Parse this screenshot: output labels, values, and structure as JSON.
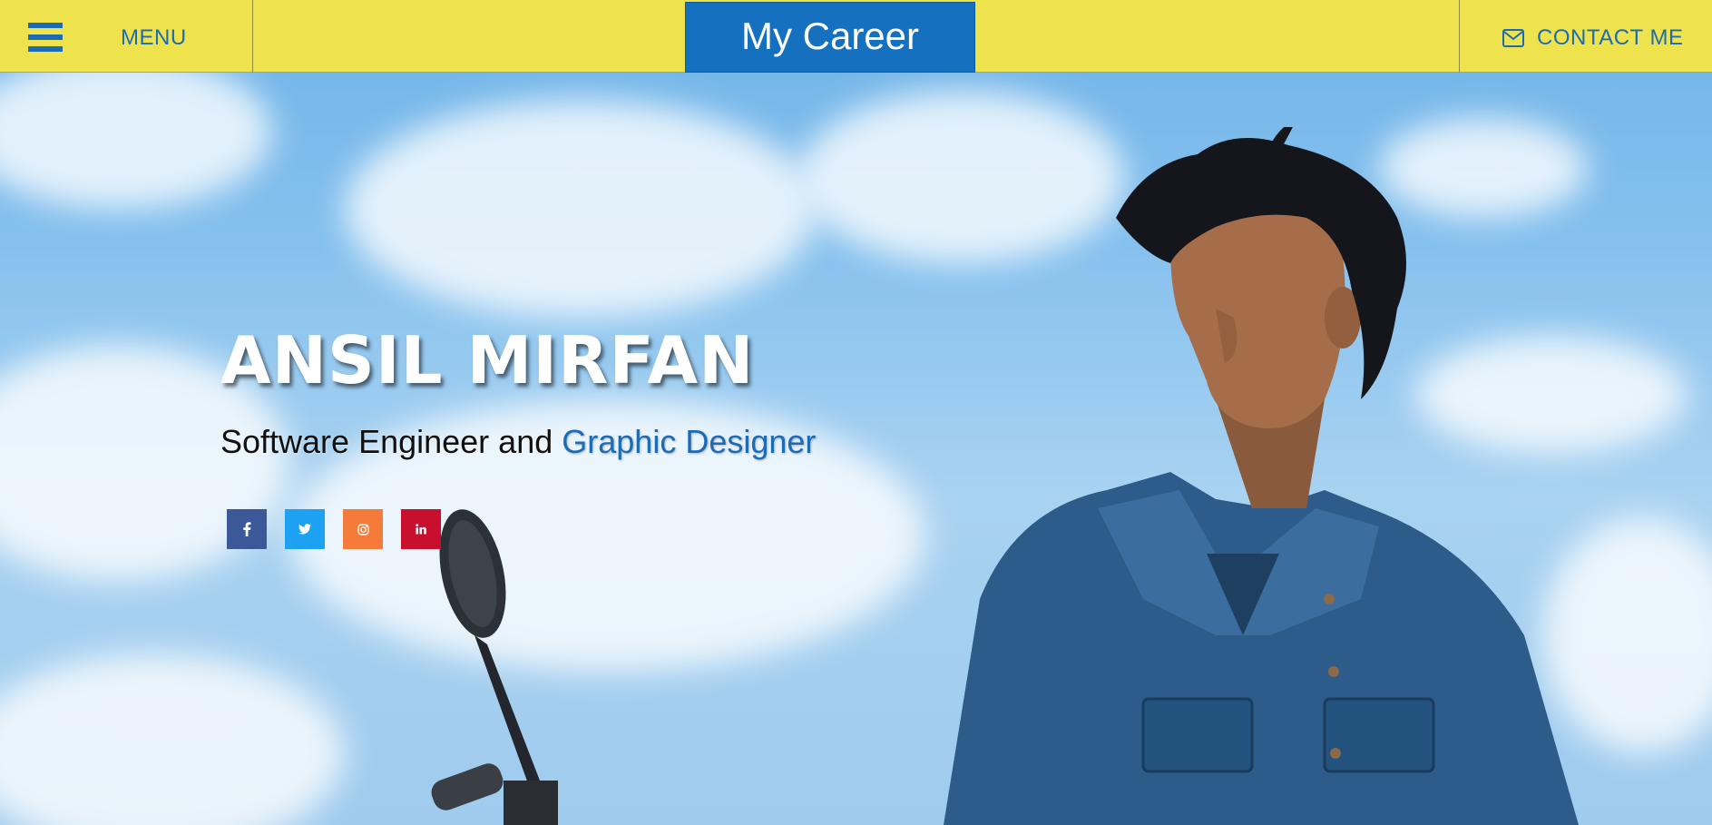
{
  "header": {
    "menu_label": "MENU",
    "brand_title": "My Career",
    "contact_label": "CONTACT ME",
    "menu_icon": "hamburger-icon",
    "contact_icon": "envelope-icon"
  },
  "hero": {
    "name": "ANSIL MIRFAN",
    "subtitle_prefix": "Software Engineer and",
    "subtitle_accent": "Graphic Designer"
  },
  "socials": [
    {
      "name": "facebook",
      "icon": "facebook-icon",
      "glyph": "f",
      "color": "#3b5998"
    },
    {
      "name": "twitter",
      "icon": "twitter-icon",
      "glyph": "t",
      "color": "#1da1f2"
    },
    {
      "name": "instagram",
      "icon": "instagram-icon",
      "glyph": "◎",
      "color": "#f47b3a"
    },
    {
      "name": "linkedin",
      "icon": "linkedin-icon",
      "glyph": "in",
      "color": "#c8102e"
    }
  ],
  "colors": {
    "header_bg": "#efe34d",
    "brand_bg": "#1570bf",
    "accent": "#1c6cb5"
  }
}
